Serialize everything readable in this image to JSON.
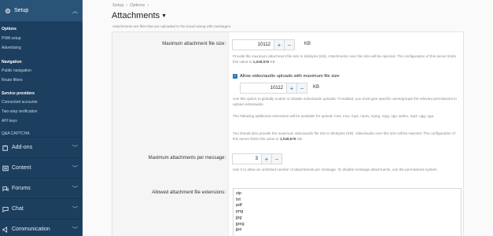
{
  "sidebar": {
    "header": {
      "label": "Setup",
      "icon": "gear-icon"
    },
    "items": [
      {
        "label": "Options",
        "active": true
      },
      {
        "label": "PWA setup"
      },
      {
        "label": "Advertising"
      }
    ],
    "groups": [
      {
        "label": "Navigation",
        "items": [
          {
            "label": "Public navigation"
          },
          {
            "label": "Route filters"
          }
        ]
      },
      {
        "label": "Service providers",
        "items": [
          {
            "label": "Connected accounts"
          },
          {
            "label": "Two-step verification"
          },
          {
            "label": "API keys"
          }
        ]
      }
    ],
    "extra_item": "Q&A CAPTCHA",
    "sections": [
      {
        "label": "Add-ons",
        "icon": "puzzle-icon"
      },
      {
        "label": "Content",
        "icon": "content-icon"
      },
      {
        "label": "Forums",
        "icon": "forums-icon"
      },
      {
        "label": "Chat",
        "icon": "chat-icon"
      },
      {
        "label": "Communication",
        "icon": "communication-icon"
      }
    ],
    "colors": {
      "bg": "#1d3f5f",
      "header_bg": "#2a5378"
    }
  },
  "breadcrumb": [
    "Setup",
    "Options"
  ],
  "page": {
    "title": "Attachments",
    "description": "Attachments are files that are uploaded to the board along with messages."
  },
  "form": {
    "max_file_size": {
      "label": "Maximum attachment file size:",
      "value": "10112",
      "unit": "KB",
      "hint_pre": "Provide file maximum attachment file size in kilobytes (KB). Attachments over this size will be rejected. The configuration of this server limits this value to ",
      "hint_limit": "1,048,576",
      "hint_post": " KB."
    },
    "video_upload": {
      "checkbox_label": "Allow video/audio uploads with maximum file size",
      "checked": true,
      "value": "10112",
      "unit": "KB",
      "hint1": "Use this option to globally enable or disable video/audio uploads. If enabled, you must give specific users/groups the relevant permissions to upload video/audio.",
      "hint2": "The following additional extensions will be available for upload: m4v, mov, mp4, mp4v, mpeg, mpg, ogv, webm, mp3, ogg, oga.",
      "hint3_pre": "You should also provide the maximum video/audio file size in kilobytes (KB). Video/audio over this size will be rejected. The configuration of this server limits this value to ",
      "hint3_limit": "1,048,576",
      "hint3_post": " KB."
    },
    "max_per_message": {
      "label": "Maximum attachments per message:",
      "value": "3",
      "hint": "Use 0 to allow an unlimited number of attachments per message. To disable message attachments, use the permissions system."
    },
    "allowed_extensions": {
      "label": "Allowed attachment file extensions:",
      "values": [
        "zip",
        "txt",
        "pdf",
        "png",
        "jpg",
        "jpeg",
        "jpe"
      ]
    }
  },
  "icons": {
    "plus": "+",
    "minus": "−",
    "accent": "#2577b1"
  }
}
